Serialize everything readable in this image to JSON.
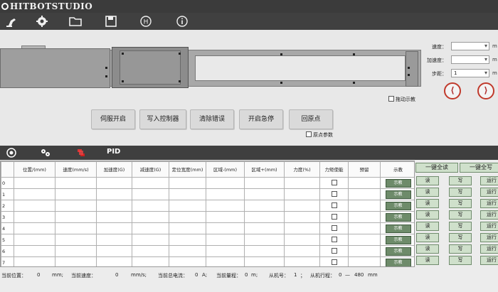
{
  "app": {
    "title": "HITBOTSTUDIO"
  },
  "toolbar": {
    "icons": [
      "robot-arm-icon",
      "gear-icon",
      "folder-icon",
      "save-icon",
      "hitbot-h-icon",
      "info-icon"
    ]
  },
  "motion": {
    "drag_teach_label": "拖动示教",
    "home_params_label": "原点参数",
    "speed_label": "速度：",
    "speed_value": "",
    "speed_unit": "m",
    "accel_label": "加速度：",
    "accel_value": "",
    "accel_unit": "m",
    "step_label": "步距：",
    "step_value": "1",
    "step_unit": "m",
    "back_arrow": "⟨",
    "forward_arrow": "⟩"
  },
  "actions": {
    "servo_on": "伺服开启",
    "write_controller": "写入控制器",
    "clear_error": "清除错误",
    "emergency_stop": "开启急停",
    "return_home": "回原点"
  },
  "section": {
    "pid_label": "PID",
    "tab_icons": [
      "target-icon",
      "gears-icon",
      "python-icon"
    ]
  },
  "table": {
    "headers": [
      "",
      "位置/(mm)",
      "速度(mm/s)",
      "加速度(G)",
      "减速度(G)",
      "定位宽度(mm)",
      "区域-(mm)",
      "区域+(mm)",
      "力度(%)",
      "力矩使能",
      "预留",
      "示教"
    ],
    "rows": [
      {
        "idx": "0",
        "teach": "示教"
      },
      {
        "idx": "1",
        "teach": "示教"
      },
      {
        "idx": "2",
        "teach": "示教"
      },
      {
        "idx": "3",
        "teach": "示教"
      },
      {
        "idx": "4",
        "teach": "示教"
      },
      {
        "idx": "5",
        "teach": "示教"
      },
      {
        "idx": "6",
        "teach": "示教"
      },
      {
        "idx": "7",
        "teach": "示教"
      }
    ]
  },
  "side": {
    "read_all": "一键全读",
    "write_all": "一键全写",
    "read": "读",
    "write": "写",
    "run": "运行"
  },
  "status": {
    "cur_pos_label": "当前位置：",
    "cur_pos_value": "0",
    "cur_pos_unit": "mm;",
    "cur_speed_label": "当前速度：",
    "cur_speed_value": "0",
    "cur_speed_unit": "mm/s;",
    "cur_current_label": "当前总电流：",
    "cur_current_value": "0",
    "cur_current_unit": "A;",
    "cur_range_label": "当前量程：",
    "cur_range_value": "0",
    "cur_range_unit": "m;",
    "slave_id_label": "从机号：",
    "slave_id_value": "1",
    "slave_id_sep": "；",
    "slave_stroke_label": "从机行程：",
    "slave_stroke_min": "0",
    "slave_stroke_dash": "—",
    "slave_stroke_max": "480",
    "slave_stroke_unit": "mm"
  }
}
